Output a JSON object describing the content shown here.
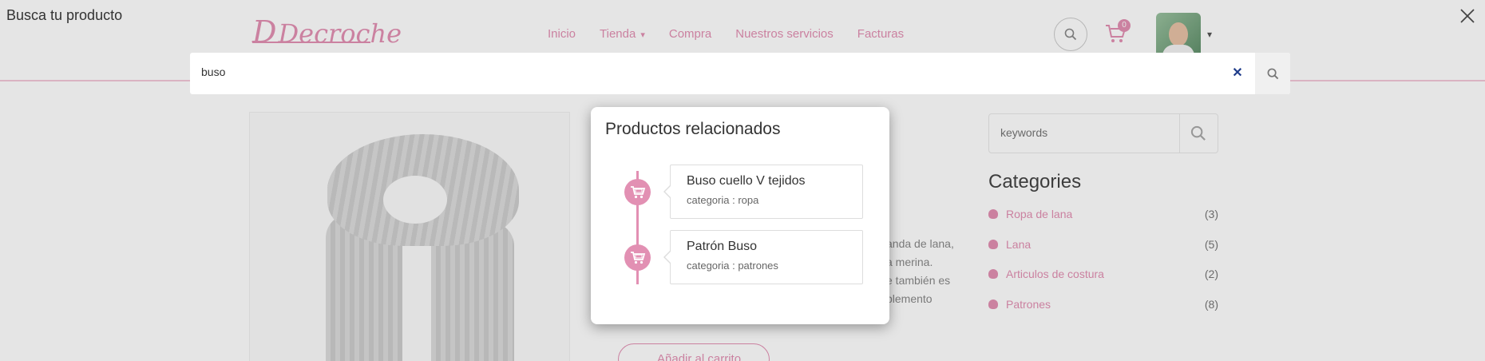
{
  "background": {
    "logo": "Decroche",
    "nav": [
      "Inicio",
      "Tienda",
      "Compra",
      "Nuestros servicios",
      "Facturas"
    ],
    "cart_count": "0",
    "description_lines": [
      "anda de lana,",
      "a merina.",
      "e también es",
      "plemento"
    ],
    "add_to_cart": "Añadir al carrito",
    "sidebar": {
      "search_placeholder": "keywords",
      "categories_title": "Categories",
      "categories": [
        {
          "label": "Ropa de lana",
          "count": "(3)"
        },
        {
          "label": "Lana",
          "count": "(5)"
        },
        {
          "label": "Articulos de costura",
          "count": "(2)"
        },
        {
          "label": "Patrones",
          "count": "(8)"
        }
      ]
    }
  },
  "search_modal": {
    "title": "Busca tu producto",
    "query": "buso",
    "results_title": "Productos relacionados",
    "results": [
      {
        "name": "Buso cuello V tejidos",
        "category": "categoria : ropa"
      },
      {
        "name": "Patrón Buso",
        "category": "categoria : patrones"
      }
    ]
  },
  "colors": {
    "accent": "#e290b3",
    "clear_icon": "#1f3c8a",
    "overlay": "rgba(0,0,0,0.10)"
  },
  "icons": {
    "close": "close-icon",
    "clear": "clear-icon",
    "search": "search-icon",
    "cart": "cart-icon"
  }
}
